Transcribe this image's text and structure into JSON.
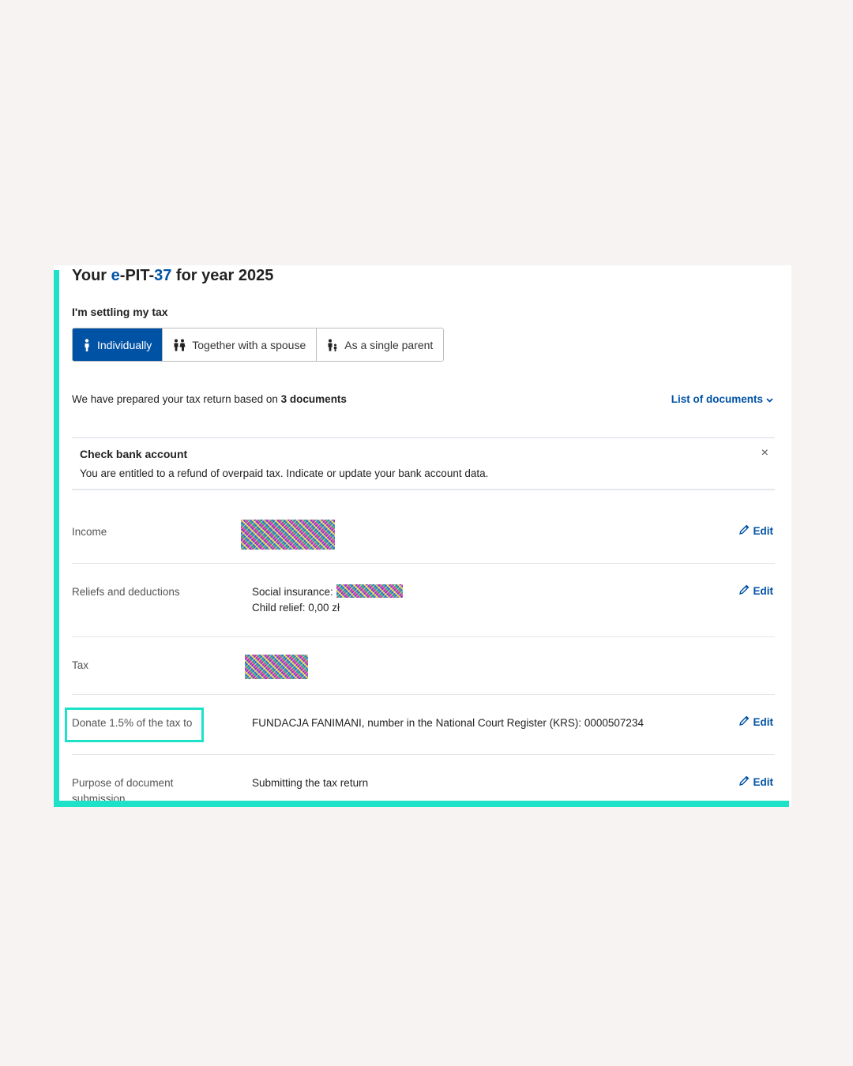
{
  "page": {
    "title_prefix": "Your ",
    "title_e": "e",
    "title_dash1": "-",
    "title_pit": "PIT",
    "title_dash2": "-",
    "title_num": "37",
    "title_suffix": " for year 2025"
  },
  "settling": {
    "label": "I'm settling my tax",
    "options": [
      "Individually",
      "Together with a spouse",
      "As a single parent"
    ],
    "selected": "Individually"
  },
  "prepared": {
    "text_before": "We have prepared your tax return based on ",
    "count_bold": "3 documents",
    "list_link": "List of documents"
  },
  "alert": {
    "title": "Check bank account",
    "text": "You are entitled to a refund of overpaid tax. Indicate or update your bank account data.",
    "close_symbol": "×"
  },
  "rows": {
    "income": {
      "label": "Income",
      "edit": "Edit"
    },
    "reliefs": {
      "label": "Reliefs and deductions",
      "social_label": "Social insurance: ",
      "child_relief": "Child relief: 0,00 zł",
      "edit": "Edit"
    },
    "tax": {
      "label": "Tax"
    },
    "donate": {
      "label": "Donate 1.5% of the tax to",
      "value": "FUNDACJA FANIMANI, number in the National Court Register (KRS): 0000507234",
      "edit": "Edit"
    },
    "purpose": {
      "label": "Purpose of document submission",
      "value": "Submitting the tax return",
      "edit": "Edit"
    }
  },
  "colors": {
    "brand_blue": "#0052a5",
    "accent_teal": "#1de2c8",
    "background": "#f7f3f3"
  },
  "icons": {
    "individual": "person-icon",
    "spouse": "couple-icon",
    "parent": "parent-child-icon",
    "edit": "pencil-icon",
    "dropdown": "chevron-down-icon",
    "close": "close-icon"
  }
}
